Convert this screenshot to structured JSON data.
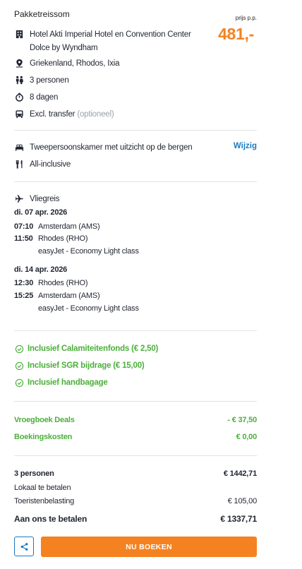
{
  "package": {
    "title": "Pakketreissom",
    "price_label": "prijs p.p.",
    "price": "481,-"
  },
  "details": {
    "hotel": "Hotel Akti Imperial Hotel en Convention Center Dolce by Wyndham",
    "location": "Griekenland, Rhodos, Ixia",
    "persons": "3 personen",
    "duration": "8 dagen",
    "transfer": "Excl. transfer",
    "transfer_note": "(optioneel)"
  },
  "room": {
    "type": "Tweepersoonskamer met uitzicht op de bergen",
    "change_label": "Wijzig",
    "board": "All-inclusive"
  },
  "flight": {
    "title": "Vliegreis",
    "outbound": {
      "date": "di. 07 apr. 2026",
      "dep_time": "07:10",
      "dep_airport": "Amsterdam (AMS)",
      "arr_time": "11:50",
      "arr_airport": "Rhodes (RHO)",
      "carrier": "easyJet - Economy Light class"
    },
    "return": {
      "date": "di. 14 apr. 2026",
      "dep_time": "12:30",
      "dep_airport": "Rhodes (RHO)",
      "arr_time": "15:25",
      "arr_airport": "Amsterdam (AMS)",
      "carrier": "easyJet - Economy Light class"
    }
  },
  "inclusions": [
    "Inclusief Calamiteitenfonds (€ 2,50)",
    "Inclusief SGR bijdrage (€ 15,00)",
    "Inclusief handbagage"
  ],
  "discounts": {
    "early_label": "Vroegboek Deals",
    "early_value": "- € 37,50",
    "booking_label": "Boekingskosten",
    "booking_value": "€ 0,00"
  },
  "summary": {
    "persons_label": "3 personen",
    "persons_total": "€ 1442,71",
    "local_label": "Lokaal te betalen",
    "tax_label": "Toeristenbelasting",
    "tax_value": "€ 105,00",
    "pay_label": "Aan ons te betalen",
    "pay_value": "€ 1337,71"
  },
  "actions": {
    "book_label": "NU BOEKEN"
  },
  "colors": {
    "accent": "#f58220",
    "link": "#1d7bbf",
    "success": "#4caf3a"
  }
}
